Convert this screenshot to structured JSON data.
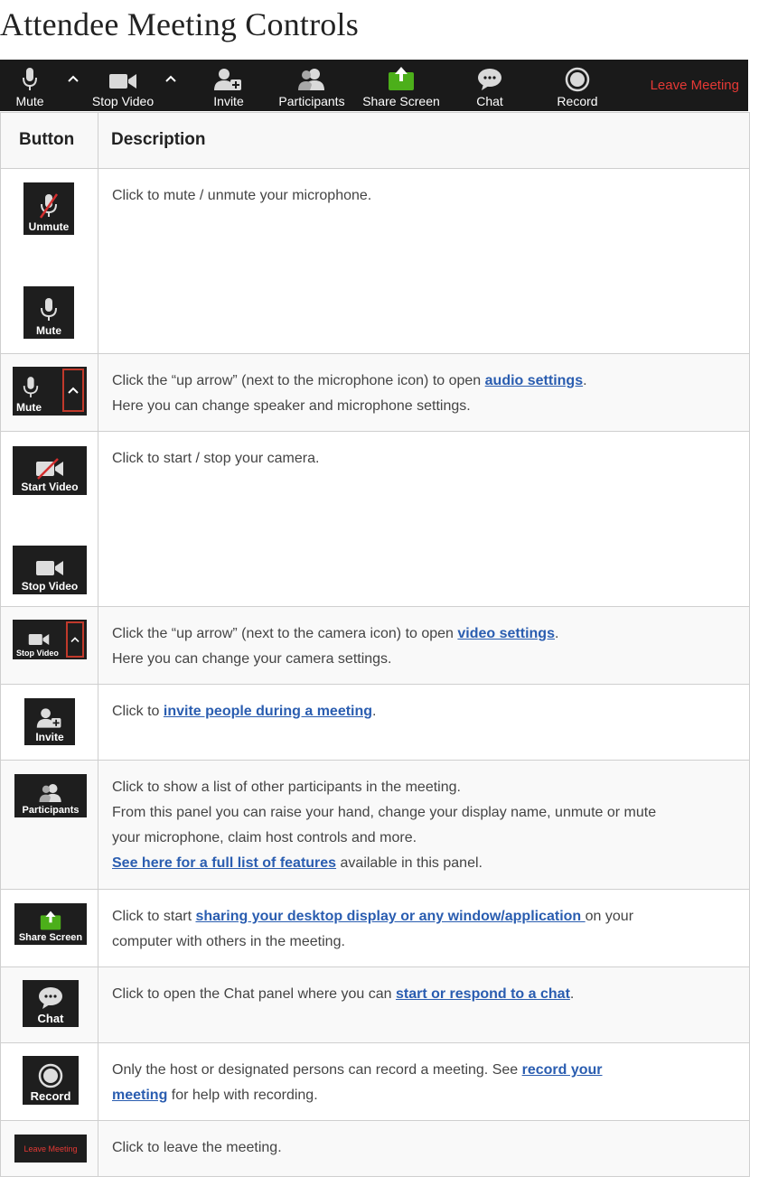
{
  "page": {
    "title": "Attendee Meeting Controls"
  },
  "toolbar": {
    "mute": "Mute",
    "stop_video": "Stop Video",
    "invite": "Invite",
    "participants": "Participants",
    "share_screen": "Share Screen",
    "chat": "Chat",
    "record": "Record",
    "leave": "Leave Meeting",
    "colors": {
      "background": "#1a1a1a",
      "share_green": "#4caf1a",
      "leave_red": "#e53935"
    }
  },
  "table": {
    "headers": {
      "button": "Button",
      "description": "Description"
    },
    "rows": {
      "mute": {
        "img_top": "Unmute",
        "img_bottom": "Mute",
        "desc": "Click to mute / unmute your microphone."
      },
      "audio": {
        "img": "Mute",
        "line1_pre": "Click the “up arrow” (next to the microphone icon) to open ",
        "line1_link": "audio settings",
        "line1_post": ".",
        "line2": "Here you can change speaker and microphone settings."
      },
      "video": {
        "img_top": "Start Video",
        "img_bottom": "Stop Video",
        "desc": "Click to start / stop your camera."
      },
      "video_settings": {
        "img": "Stop Video",
        "line1_pre": "Click the “up arrow” (next to the camera icon) to open ",
        "line1_link": "video settings",
        "line1_post": ".",
        "line2": "Here you can change your camera settings."
      },
      "invite": {
        "img": "Invite",
        "pre": "Click to ",
        "link": "invite people during a meeting",
        "post": "."
      },
      "participants": {
        "img": "Participants",
        "line1": "Click to show a list of other participants in the meeting.",
        "line2": "From this panel you can raise your hand, change your display name, unmute or mute",
        "line3": "your microphone, claim host controls and more.",
        "line4_link": "See here for a full list of features",
        "line4_post": " available in this panel."
      },
      "share": {
        "img": "Share Screen",
        "pre": "Click to start ",
        "link": "sharing your desktop display or any window/application ",
        "post": "on your",
        "line2": "computer with others in the meeting."
      },
      "chat": {
        "img": "Chat",
        "pre": "Click to open the Chat panel where you can ",
        "link": "start or respond to a chat",
        "post": "."
      },
      "record": {
        "img": "Record",
        "pre": "Only the host or designated persons can record a meeting. See ",
        "link1": "record your",
        "link2": "meeting",
        "post": " for help with recording."
      },
      "leave": {
        "img": "Leave Meeting",
        "desc": "Click to leave the meeting."
      }
    }
  }
}
